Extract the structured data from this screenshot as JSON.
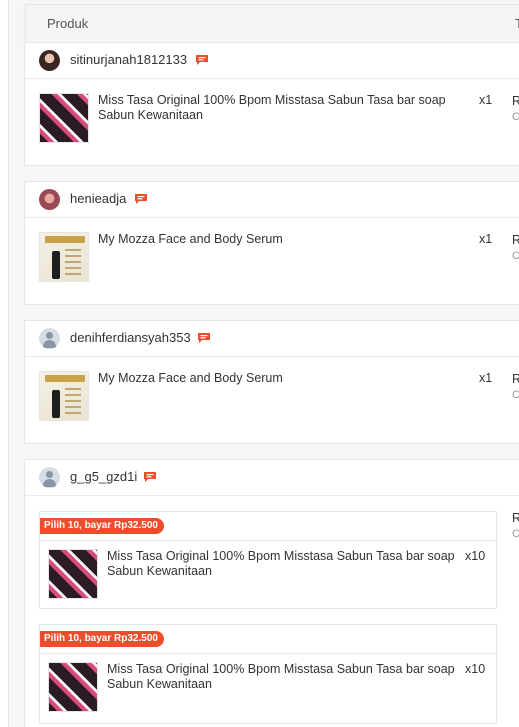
{
  "header": {
    "col_product": "Produk",
    "col_total_partial": "T"
  },
  "colors": {
    "accent": "#ee4d2d",
    "chat_icon": "#ee4d2d"
  },
  "orders": [
    {
      "username": "sitinurjanah1812133",
      "avatar": "photo",
      "items": [
        {
          "name": "Miss Tasa Original 100% Bpom Misstasa Sabun Tasa bar soap Sabun Kewanitaan",
          "qty": "x1",
          "thumb": "soap-product-image"
        }
      ],
      "right_col": "R",
      "right_sub": "C"
    },
    {
      "username": "henieadja",
      "avatar": "photo",
      "items": [
        {
          "name": "My Mozza Face and Body Serum",
          "qty": "x1",
          "thumb": "serum-product-image"
        }
      ],
      "right_col": "R",
      "right_sub": "C"
    },
    {
      "username": "denihferdiansyah353",
      "avatar": "generic-user-icon",
      "items": [
        {
          "name": "My Mozza Face and Body Serum",
          "qty": "x1",
          "thumb": "serum-product-image"
        }
      ],
      "right_col": "R",
      "right_sub": "C"
    },
    {
      "username": "g_g5_gzd1i",
      "avatar": "generic-user-icon",
      "bundles": [
        {
          "promo": "Pilih 10, bayar Rp32.500",
          "name": "Miss Tasa Original 100% Bpom Misstasa Sabun Tasa bar soap Sabun Kewanitaan",
          "qty": "x10",
          "thumb": "soap-product-image"
        },
        {
          "promo": "Pilih 10, bayar Rp32.500",
          "name": "Miss Tasa Original 100% Bpom Misstasa Sabun Tasa bar soap Sabun Kewanitaan",
          "qty": "x10",
          "thumb": "soap-product-image"
        }
      ],
      "right_col": "R",
      "right_sub": "C"
    }
  ]
}
